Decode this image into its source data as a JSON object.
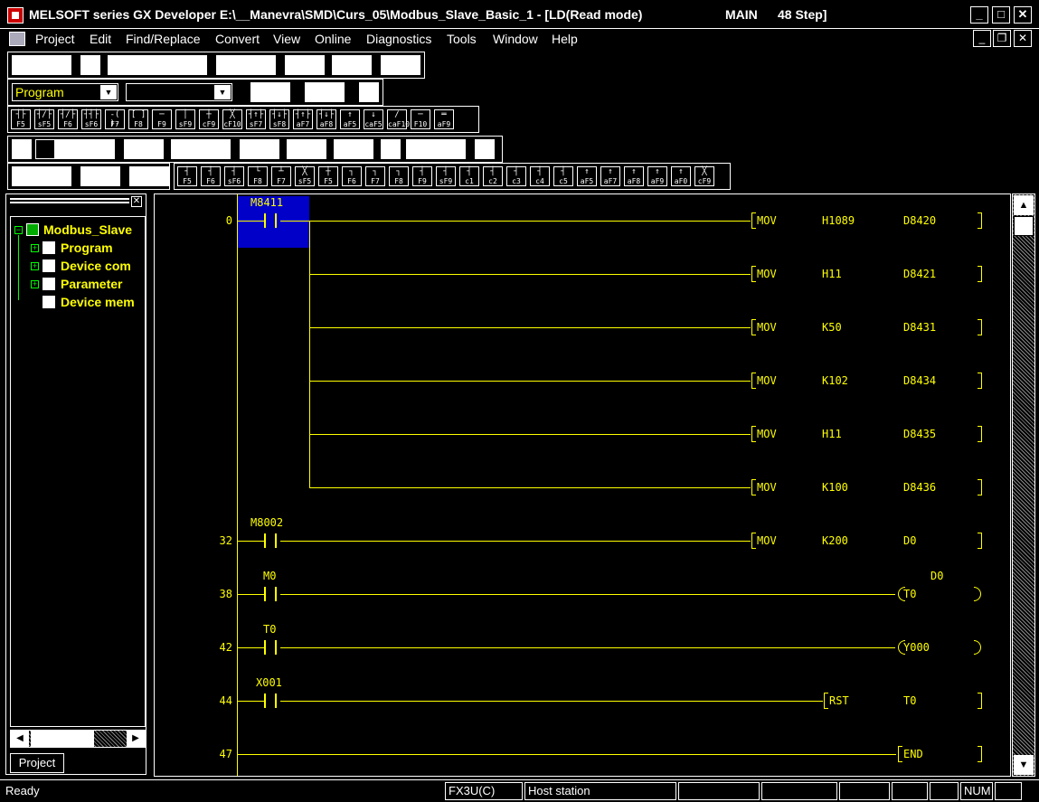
{
  "window": {
    "title": "MELSOFT series GX Developer E:\\__Manevra\\SMD\\Curs_05\\Modbus_Slave_Basic_1 - [LD(Read mode)",
    "program": "MAIN",
    "steps": "48 Step]"
  },
  "menu": [
    "Project",
    "Edit",
    "Find/Replace",
    "Convert",
    "View",
    "Online",
    "Diagnostics",
    "Tools",
    "Window",
    "Help"
  ],
  "combos": {
    "data_type": "Program",
    "second": ""
  },
  "fkeys_row1": [
    {
      "sym": "┤├",
      "key": "F5"
    },
    {
      "sym": "┤/├",
      "key": "sF5"
    },
    {
      "sym": "┤/├",
      "key": "F6"
    },
    {
      "sym": "┤┤├",
      "key": "sF6"
    },
    {
      "sym": "-( )-",
      "key": "F7"
    },
    {
      "sym": "[ ]",
      "key": "F8"
    },
    {
      "sym": "─",
      "key": "F9"
    },
    {
      "sym": "│",
      "key": "sF9"
    },
    {
      "sym": "┼",
      "key": "cF9"
    },
    {
      "sym": "╳",
      "key": "cF10"
    },
    {
      "sym": "┤↑├",
      "key": "sF7"
    },
    {
      "sym": "┤↓├",
      "key": "sF8"
    },
    {
      "sym": "┤↑├",
      "key": "aF7"
    },
    {
      "sym": "┤↓├",
      "key": "aF8"
    },
    {
      "sym": "↑",
      "key": "aF5"
    },
    {
      "sym": "↓",
      "key": "caF5"
    },
    {
      "sym": "/",
      "key": "caF10"
    },
    {
      "sym": "─",
      "key": "F10"
    },
    {
      "sym": "═",
      "key": "aF9"
    }
  ],
  "fkeys_row4": [
    {
      "sym": "┤",
      "key": "F5"
    },
    {
      "sym": "┤",
      "key": "F6"
    },
    {
      "sym": "┤",
      "key": "sF6"
    },
    {
      "sym": "└",
      "key": "F8"
    },
    {
      "sym": "┴",
      "key": "F7"
    },
    {
      "sym": "╳",
      "key": "sF5"
    },
    {
      "sym": "┼",
      "key": "F5"
    },
    {
      "sym": "┐",
      "key": "F6"
    },
    {
      "sym": "┐",
      "key": "F7"
    },
    {
      "sym": "┐",
      "key": "F8"
    },
    {
      "sym": "┤",
      "key": "F9"
    },
    {
      "sym": "┤",
      "key": "sF9"
    },
    {
      "sym": "┤",
      "key": "c1"
    },
    {
      "sym": "┤",
      "key": "c2"
    },
    {
      "sym": "┤",
      "key": "c3"
    },
    {
      "sym": "┤",
      "key": "c4"
    },
    {
      "sym": "┤",
      "key": "c5"
    },
    {
      "sym": "↑",
      "key": "aF5"
    },
    {
      "sym": "↑",
      "key": "aF7"
    },
    {
      "sym": "↑",
      "key": "aF8"
    },
    {
      "sym": "↑",
      "key": "aF9"
    },
    {
      "sym": "↑",
      "key": "aF0"
    },
    {
      "sym": "╳",
      "key": "cF9"
    }
  ],
  "project_tree": {
    "root": "Modbus_Slave",
    "items": [
      "Program",
      "Device com",
      "Parameter",
      "Device mem"
    ],
    "tab": "Project"
  },
  "ladder": {
    "rungs": [
      {
        "step": "0",
        "contact": "M8411",
        "instr": [
          {
            "op": "MOV",
            "a": "H1089",
            "b": "D8420"
          },
          {
            "op": "MOV",
            "a": "H11",
            "b": "D8421"
          },
          {
            "op": "MOV",
            "a": "K50",
            "b": "D8431"
          },
          {
            "op": "MOV",
            "a": "K102",
            "b": "D8434"
          },
          {
            "op": "MOV",
            "a": "H11",
            "b": "D8435"
          },
          {
            "op": "MOV",
            "a": "K100",
            "b": "D8436"
          }
        ]
      },
      {
        "step": "32",
        "contact": "M8002",
        "op": "MOV",
        "a": "K200",
        "b": "D0"
      },
      {
        "step": "38",
        "contact": "M0",
        "coil": "T0",
        "coil_param": "D0"
      },
      {
        "step": "42",
        "contact": "T0",
        "coil": "Y000"
      },
      {
        "step": "44",
        "contact": "X001",
        "op": "RST",
        "a": "T0"
      },
      {
        "step": "47",
        "op": "END"
      }
    ]
  },
  "status": {
    "left": "Ready",
    "plc": "FX3U(C)",
    "station": "Host station",
    "num": "NUM"
  },
  "colors": {
    "ladder": "#ffff00",
    "cursor": "#0000c8",
    "background": "#000000",
    "tree_expander": "#00ff00"
  }
}
